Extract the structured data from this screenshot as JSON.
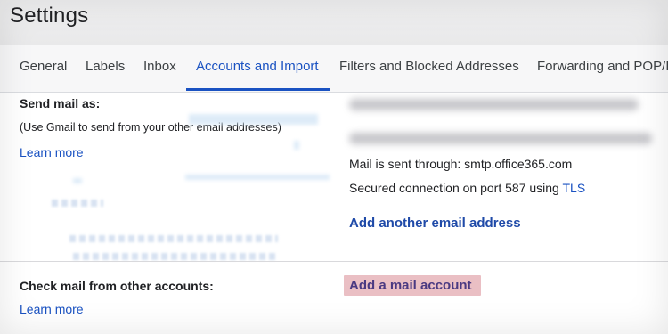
{
  "header": {
    "title": "Settings"
  },
  "tabs": [
    {
      "label": "General",
      "active": false
    },
    {
      "label": "Labels",
      "active": false
    },
    {
      "label": "Inbox",
      "active": false
    },
    {
      "label": "Accounts and Import",
      "active": true
    },
    {
      "label": "Filters and Blocked Addresses",
      "active": false
    },
    {
      "label": "Forwarding and POP/IM",
      "active": false
    }
  ],
  "send_mail": {
    "title": "Send mail as:",
    "description": "(Use Gmail to send from your other email addresses)",
    "learn_more": "Learn more",
    "mail_sent_through": "Mail is sent through: smtp.office365.com",
    "secured_prefix": "Secured connection on port 587 using ",
    "tls_label": "TLS",
    "add_address": "Add another email address"
  },
  "check_mail": {
    "title": "Check mail from other accounts:",
    "learn_more": "Learn more",
    "add_account": "Add a mail account"
  },
  "colors": {
    "accent": "#1a52c2",
    "highlight": "#e3a9b0"
  }
}
